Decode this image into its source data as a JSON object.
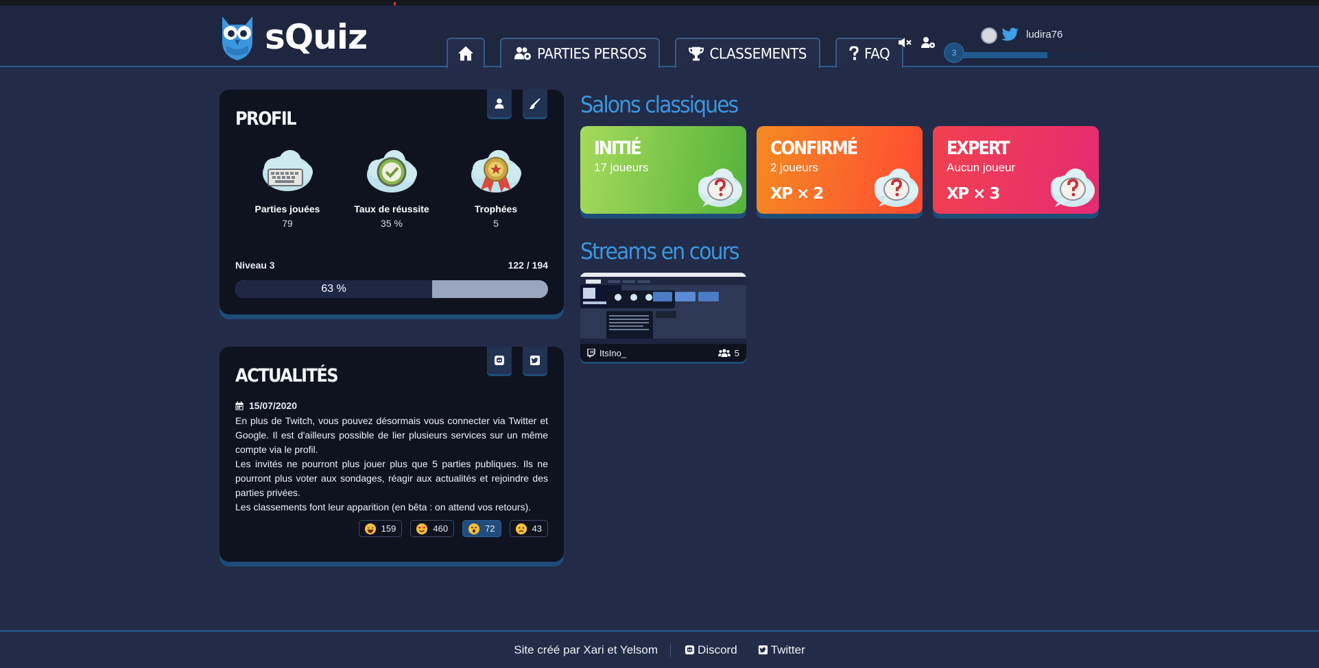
{
  "app": {
    "name": "sQuiz"
  },
  "nav": {
    "home": "home-icon",
    "items": [
      {
        "label": "PARTIES PERSOS",
        "icon": "users-cog-icon"
      },
      {
        "label": "CLASSEMENTS",
        "icon": "trophy-icon"
      },
      {
        "label": "FAQ",
        "icon": "question-icon"
      }
    ]
  },
  "header": {
    "icons": [
      "mute-icon",
      "user-cog-icon"
    ],
    "user": {
      "name": "ludira76",
      "level": "3",
      "xp_fraction": 0.63
    }
  },
  "profile": {
    "title": "PROFIL",
    "stats": [
      {
        "label": "Parties jouées",
        "value": "79",
        "icon": "keyboard-cloud-icon"
      },
      {
        "label": "Taux de réussite",
        "value": "35 %",
        "icon": "check-cloud-icon"
      },
      {
        "label": "Trophées",
        "value": "5",
        "icon": "medal-cloud-icon"
      }
    ],
    "level_label": "Niveau 3",
    "xp": "122 / 194",
    "progress_label": "63 %",
    "progress_fraction": 0.63
  },
  "news": {
    "title": "ACTUALITÉS",
    "date": "15/07/2020",
    "paragraphs": [
      "En plus de Twitch, vous pouvez désormais vous connecter via Twitter et Google. Il est d'ailleurs possible de lier plusieurs services sur un même compte via le profil.",
      "Les invités ne pourront plus jouer plus que 5 parties publiques. Ils ne pourront plus voter aux sondages, réagir aux actualités et rejoindre des parties privées.",
      "Les classements font leur apparition (en bêta : on attend vos retours)."
    ],
    "reactions": [
      {
        "count": "159",
        "emoji": "laugh-emoji",
        "active": false
      },
      {
        "count": "460",
        "emoji": "love-emoji",
        "active": false
      },
      {
        "count": "72",
        "emoji": "surprised-emoji",
        "active": true
      },
      {
        "count": "43",
        "emoji": "sad-emoji",
        "active": false
      }
    ]
  },
  "salons": {
    "title": "Salons classiques",
    "items": [
      {
        "name": "INITIÉ",
        "players": "17 joueurs",
        "xp": "",
        "colors": [
          "#a6da5c",
          "#55b33a"
        ]
      },
      {
        "name": "CONFIRMÉ",
        "players": "2 joueurs",
        "xp": "XP × 2",
        "colors": [
          "#f48a22",
          "#ff4a32"
        ]
      },
      {
        "name": "EXPERT",
        "players": "Aucun joueur",
        "xp": "XP × 3",
        "colors": [
          "#f04150",
          "#e62b72"
        ]
      }
    ]
  },
  "streams": {
    "title": "Streams en cours",
    "items": [
      {
        "streamer": "ItsIno_",
        "viewers": "5"
      }
    ]
  },
  "footer": {
    "credit": "Site créé par Xari et Yelsom",
    "links": [
      "Discord",
      "Twitter"
    ]
  },
  "colors": {
    "accent": "#3b96de",
    "bg": "#222b47",
    "card": "#0f1320",
    "shadow": "#1d4d77"
  }
}
